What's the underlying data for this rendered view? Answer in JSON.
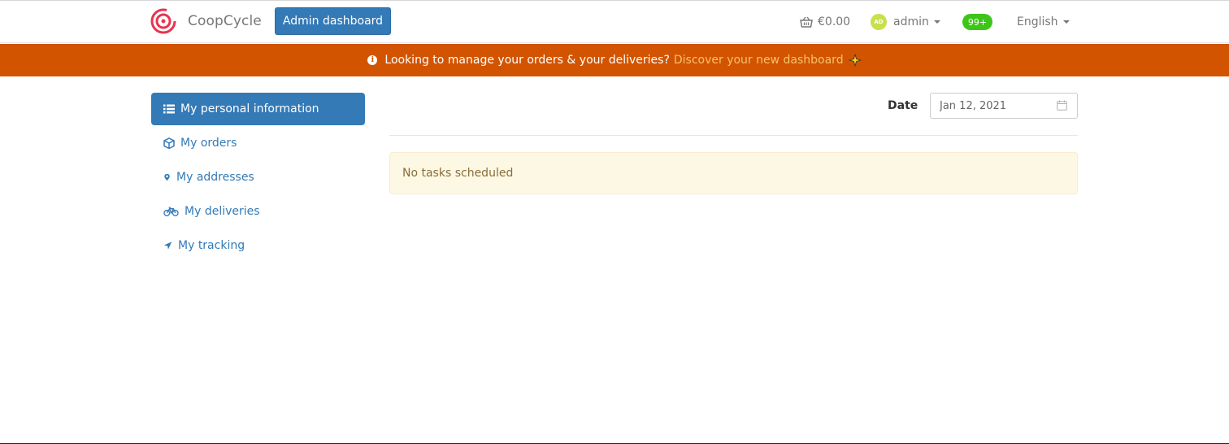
{
  "navbar": {
    "brand_name": "CoopCycle",
    "admin_button": "Admin dashboard",
    "cart_amount": "€0.00",
    "user_initials": "AD",
    "username": "admin",
    "notifications": "99+",
    "language": "English"
  },
  "banner": {
    "text": "Looking to manage your orders & your deliveries?",
    "link": "Discover your new dashboard"
  },
  "sidebar": {
    "items": [
      {
        "label": "My personal information",
        "icon": "list-icon"
      },
      {
        "label": "My orders",
        "icon": "cube-icon"
      },
      {
        "label": "My addresses",
        "icon": "map-marker-icon"
      },
      {
        "label": "My deliveries",
        "icon": "bicycle-icon"
      },
      {
        "label": "My tracking",
        "icon": "location-arrow-icon"
      }
    ]
  },
  "main": {
    "date_label": "Date",
    "date_value": "Jan 12, 2021",
    "empty_message": "No tasks scheduled"
  },
  "colors": {
    "primary": "#337ab7",
    "banner": "#d35400",
    "banner_link": "#f5c26b",
    "badge": "#3ec51a",
    "alert_bg": "#fcf8e3",
    "alert_text": "#8a6d3b"
  }
}
